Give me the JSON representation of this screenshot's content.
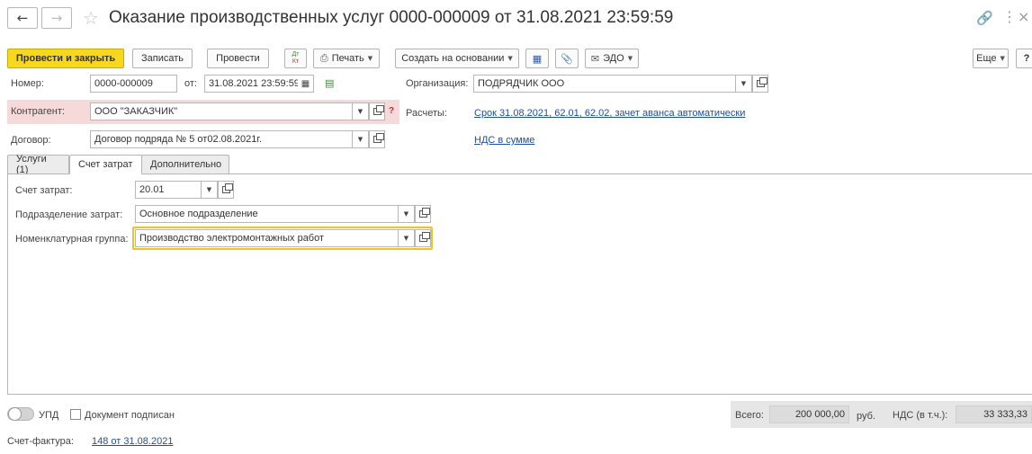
{
  "window": {
    "title": "Оказание производственных услуг 0000-000009 от 31.08.2021 23:59:59"
  },
  "toolbar": {
    "post_and_close": "Провести и закрыть",
    "save": "Записать",
    "post": "Провести",
    "dt_kt_top": "Дт",
    "dt_kt_bottom": "Кт",
    "print": "Печать",
    "create_based_on": "Создать на основании",
    "edo": "ЭДО",
    "more": "Еще",
    "help": "?"
  },
  "header": {
    "number_label": "Номер:",
    "number_value": "0000-000009",
    "date_label": "от:",
    "date_value": "31.08.2021 23:59:59",
    "organization_label": "Организация:",
    "organization_value": "ПОДРЯДЧИК ООО",
    "counterparty_label": "Контрагент:",
    "counterparty_value": "ООО \"ЗАКАЗЧИК\"",
    "counterparty_help": "?",
    "settlements_label": "Расчеты:",
    "settlements_link": "Срок 31.08.2021, 62.01, 62.02, зачет аванса автоматически",
    "contract_label": "Договор:",
    "contract_value": "Договор подряда № 5 от02.08.2021г.",
    "vat_link": "НДС в сумме"
  },
  "tabs": [
    {
      "label": "Услуги (1)"
    },
    {
      "label": "Счет затрат"
    },
    {
      "label": "Дополнительно"
    }
  ],
  "cost_tab": {
    "account_label": "Счет затрат:",
    "account_value": "20.01",
    "division_label": "Подразделение затрат:",
    "division_value": "Основное подразделение",
    "item_group_label": "Номенклатурная группа:",
    "item_group_value": "Производство электромонтажных работ"
  },
  "footer": {
    "upd_label": "УПД",
    "signed_label": "Документ подписан",
    "total_label": "Всего:",
    "total_value": "200 000,00",
    "currency": "руб.",
    "vat_label": "НДС (в т.ч.):",
    "vat_value": "33 333,33",
    "invoice_label": "Счет-фактура:",
    "invoice_link": "148 от 31.08.2021"
  },
  "colors": {
    "primary_button": "#f7d81f",
    "required_highlight": "#f6d9d9",
    "focus_border": "#f0c22a",
    "link": "#1f4fa0"
  }
}
